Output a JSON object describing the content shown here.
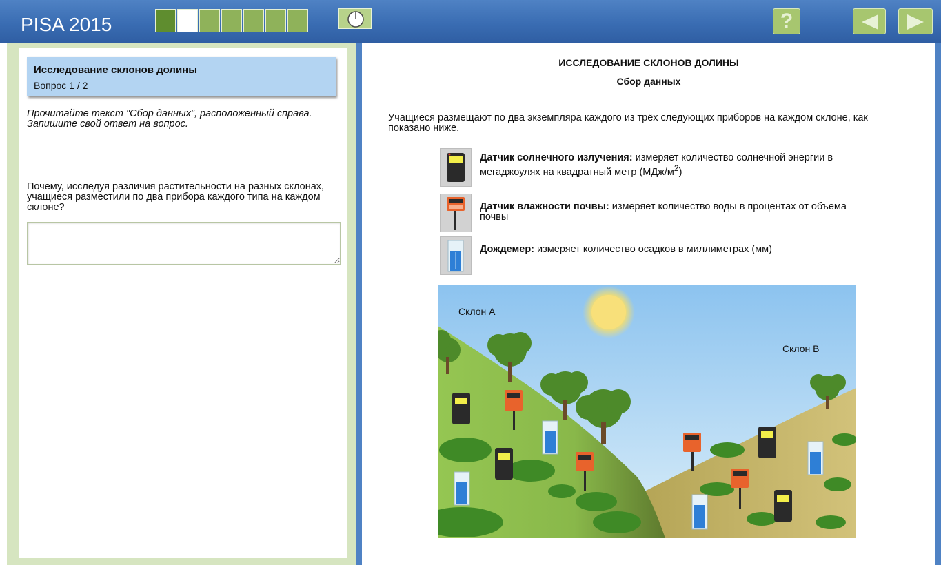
{
  "header": {
    "app_title": "PISA 2015",
    "progress": {
      "total": 7,
      "current": 2
    },
    "help_label": "?"
  },
  "question_panel": {
    "unit_title": "Исследование склонов долины",
    "question_number": "Вопрос 1 / 2",
    "instruction": "Прочитайте текст \"Сбор данных\", расположенный справа. Запишите свой ответ на вопрос.",
    "question_text": "Почему, исследуя различия растительности на разных склонах, учащиеся разместили по два прибора каждого типа на каждом склоне?",
    "answer_value": ""
  },
  "stimulus": {
    "title": "ИССЛЕДОВАНИЕ СКЛОНОВ ДОЛИНЫ",
    "subtitle": "Сбор данных",
    "intro": "Учащиеся размещают по два экземпляра каждого из трёх следующих приборов на каждом склоне, как показано ниже.",
    "devices": [
      {
        "name": "Датчик солнечного излучения:",
        "desc": " измеряет количество солнечной энергии в мегаджоулях на квадратный метр (МДж/м",
        "sup": "2",
        "tail": ")",
        "icon": "solar-sensor-icon"
      },
      {
        "name": "Датчик влажности почвы:",
        "desc": " измеряет количество воды в процентах от объема почвы",
        "icon": "soil-moisture-sensor-icon"
      },
      {
        "name": "Дождемер:",
        "desc": " измеряет количество осадков в миллиметрах (мм)",
        "icon": "rain-gauge-icon"
      }
    ],
    "slope_a_label": "Склон А",
    "slope_b_label": "Склон В"
  },
  "colors": {
    "header_blue": "#3a6db3",
    "progress_green": "#8fb25a",
    "panel_green": "#d6e5c0",
    "question_header": "#b3d4f2"
  }
}
